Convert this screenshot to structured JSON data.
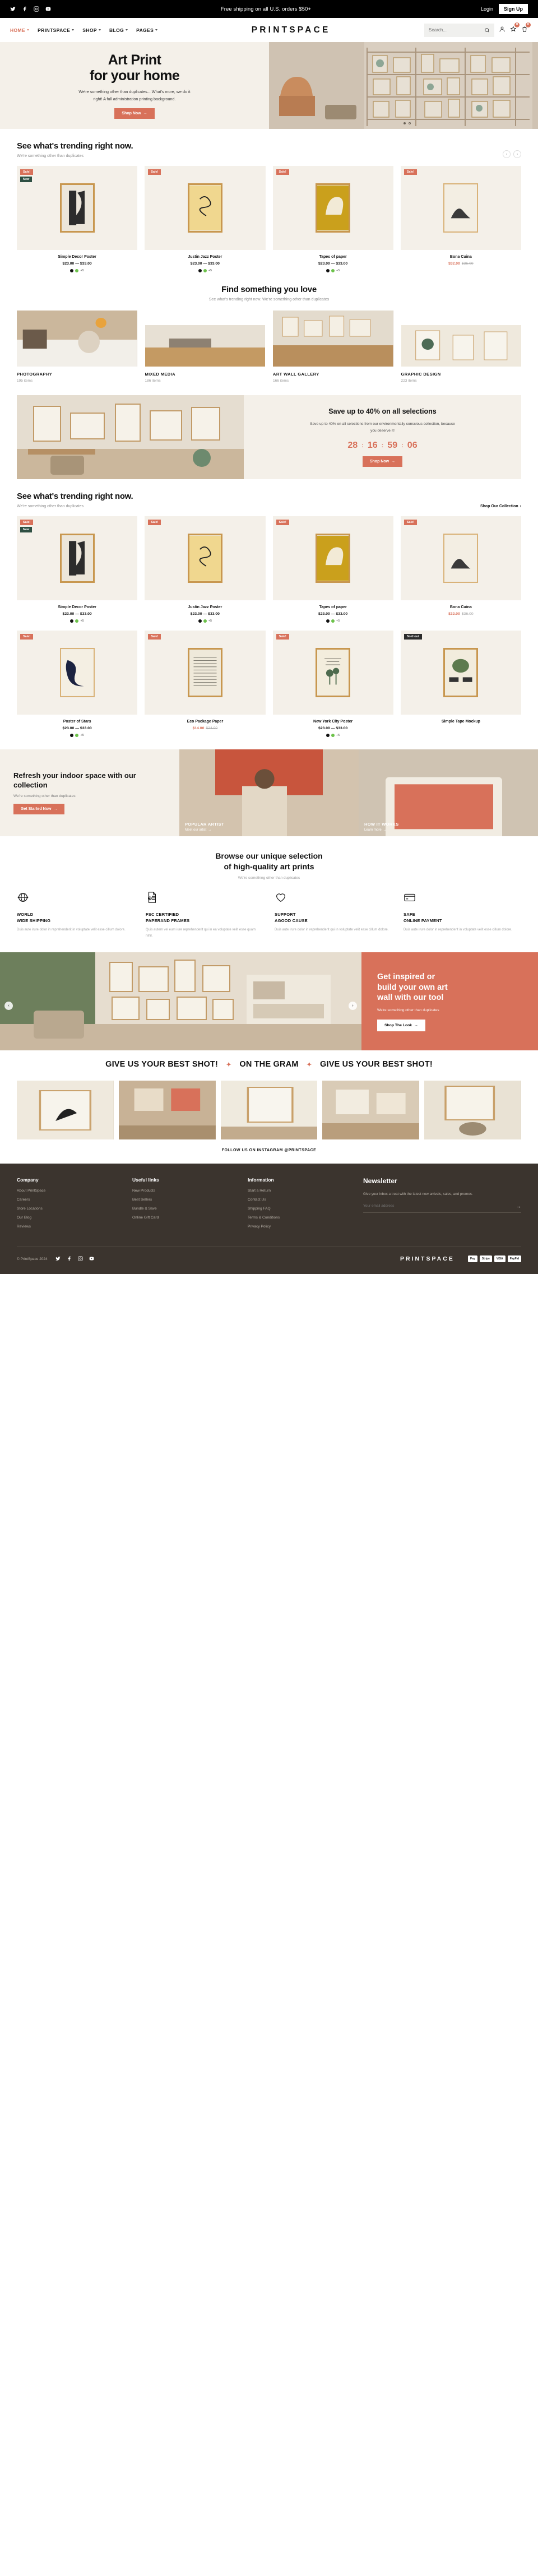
{
  "announcement": {
    "message": "Free shipping on all U.S. orders $50+",
    "login": "Login",
    "signup": "Sign Up",
    "socials": [
      "twitter-icon",
      "facebook-icon",
      "instagram-icon",
      "youtube-icon"
    ]
  },
  "header": {
    "logo": "PRINTSPACE",
    "nav": [
      {
        "label": "HOME"
      },
      {
        "label": "PRINTSPACE"
      },
      {
        "label": "SHOP"
      },
      {
        "label": "BLOG"
      },
      {
        "label": "PAGES"
      }
    ],
    "search_placeholder": "Search...",
    "wishlist_count": "0",
    "cart_count": "0"
  },
  "hero": {
    "title_line1": "Art Print",
    "title_line2": "for your home",
    "paragraph": "We're something other than duplicates... What's more, we do it right! A full administration printing background.",
    "cta": "Shop Now"
  },
  "trending1": {
    "title": "See what's trending right now.",
    "subtitle": "We're something other than duplicates"
  },
  "trending2": {
    "title": "See what's trending right now.",
    "subtitle": "We're something other than duplicates",
    "link": "Shop Our Collection"
  },
  "products_row1": [
    {
      "name": "Simple Decor Poster",
      "price": "$23.00 — $33.00",
      "tags": [
        "Sale!",
        "New"
      ],
      "swatch_more": "+5"
    },
    {
      "name": "Justin Jazz Poster",
      "price": "$23.00 — $33.00",
      "tags": [
        "Sale!"
      ],
      "swatch_more": "+5"
    },
    {
      "name": "Tapes of paper",
      "price": "$23.00 — $33.00",
      "tags": [
        "Sale!"
      ],
      "swatch_more": "+5"
    },
    {
      "name": "Bona Cuina",
      "price": "$32.00",
      "old_price": "$36.00",
      "tags": [
        "Sale!"
      ],
      "swatch_more": ""
    }
  ],
  "products_row2": [
    {
      "name": "Simple Decor Poster",
      "price": "$23.00 — $33.00",
      "tags": [
        "Sale!",
        "New"
      ],
      "swatch_more": "+5"
    },
    {
      "name": "Justin Jazz Poster",
      "price": "$23.00 — $33.00",
      "tags": [
        "Sale!"
      ],
      "swatch_more": "+5"
    },
    {
      "name": "Tapes of paper",
      "price": "$23.00 — $33.00",
      "tags": [
        "Sale!"
      ],
      "swatch_more": "+5"
    },
    {
      "name": "Bona Cuina",
      "price": "$32.00",
      "old_price": "$36.00",
      "tags": [
        "Sale!"
      ],
      "swatch_more": ""
    }
  ],
  "products_row3": [
    {
      "name": "Poster of Stars",
      "price": "$23.00 — $33.00",
      "tags": [
        "Sale!"
      ],
      "swatch_more": "+5"
    },
    {
      "name": "Eco Package Paper",
      "price": "$14.00",
      "old_price": "$24.00",
      "tags": [
        "Sale!"
      ],
      "swatch_more": ""
    },
    {
      "name": "New York City Poster",
      "price": "$23.00 — $33.00",
      "tags": [
        "Sale!"
      ],
      "swatch_more": "+5"
    },
    {
      "name": "Simple Tape Mockup",
      "price": "",
      "tags": [
        "Sold out"
      ],
      "swatch_more": ""
    }
  ],
  "find": {
    "title": "Find something you love",
    "subtitle": "See what's trending right now. We're something other than duplicates"
  },
  "categories": [
    {
      "name": "PHOTOGRAPHY",
      "items": "195 items"
    },
    {
      "name": "MIXED MEDIA",
      "items": "186 items"
    },
    {
      "name": "ART WALL GALLERY",
      "items": "166 items"
    },
    {
      "name": "GRAPHIC DESIGN",
      "items": "223 items"
    }
  ],
  "promo": {
    "title": "Save up to 40% on all selections",
    "text": "Save up to 40% on all selections from our environmentally conscious collection, because you deserve it!",
    "countdown": [
      "28",
      "16",
      "59",
      "06"
    ],
    "cta": "Shop Now"
  },
  "band": {
    "title": "Refresh your indoor space with our collection",
    "subtitle": "We're something other than duplicates",
    "cta": "Get Started Now",
    "tiles": [
      {
        "title": "POPULAR ARTIST",
        "sub": "Meet our artist"
      },
      {
        "title": "HOW IT WORKS",
        "sub": "Learn more"
      }
    ]
  },
  "features": {
    "title_line1": "Browse our unique selection",
    "title_line2": "of high-quality art prints",
    "subtitle": "We're something other than duplicates",
    "items": [
      {
        "icon": "globe-icon",
        "title": "WORLD\nWIDE SHIPPING",
        "desc": "Duis aute irure dolor in reprehenderit in voluptate velit esse cillum dolore."
      },
      {
        "icon": "document-icon",
        "title": "FSC CERTIFIED\nPAPERAND FRAMES",
        "desc": "Quis autem vel eum iure reprehenderit qui in ea voluptate velit esse quam nihil."
      },
      {
        "icon": "heart-icon",
        "title": "SUPPORT\nAGOOD CAUSE",
        "desc": "Duis aute irure dolor in reprehenderit qui in voluptate velit esse cillum dolore."
      },
      {
        "icon": "card-icon",
        "title": "SAFE\nONLINE PAYMENT",
        "desc": "Duis aute irure dolor in reprehenderit in voluptate velit esse cillum dolore."
      }
    ]
  },
  "inspire": {
    "title_line1": "Get inspired or",
    "title_line2": "build your own art",
    "title_line3": "wall with our tool",
    "subtitle": "We're something other than duplicates",
    "cta": "Shop The Look"
  },
  "marquee": {
    "text_a": "GIVE US YOUR BEST SHOT!",
    "text_b": "ON THE GRAM",
    "text_c": "GIVE US YOUR BEST SHOT!",
    "follow": "FOLLOW US ON INSTAGRAM @PRINTSPACE"
  },
  "footer": {
    "columns": [
      {
        "heading": "Company",
        "links": [
          "About PrintSpace",
          "Careers",
          "Store Locations",
          "Our Blog",
          "Reviews"
        ]
      },
      {
        "heading": "Useful links",
        "links": [
          "New Products",
          "Best Sellers",
          "Bundle & Save",
          "Online Gift Card"
        ]
      },
      {
        "heading": "Information",
        "links": [
          "Start a Return",
          "Contact Us",
          "Shipping FAQ",
          "Terms & Conditions",
          "Privacy Policy"
        ]
      }
    ],
    "newsletter": {
      "heading": "Newsletter",
      "text": "Give your inbox a treat with the latest new arrivals, sales, and promos.",
      "placeholder": "Your email address"
    },
    "copyright": "© PrintSpace 2024",
    "brand": "PRINTSPACE",
    "payments": [
      "Pay",
      "Stripe",
      "VISA",
      "PayPal"
    ]
  },
  "colors": {
    "accent": "#d8715a",
    "cream": "#f4f0e9",
    "dark": "#3b342e"
  }
}
